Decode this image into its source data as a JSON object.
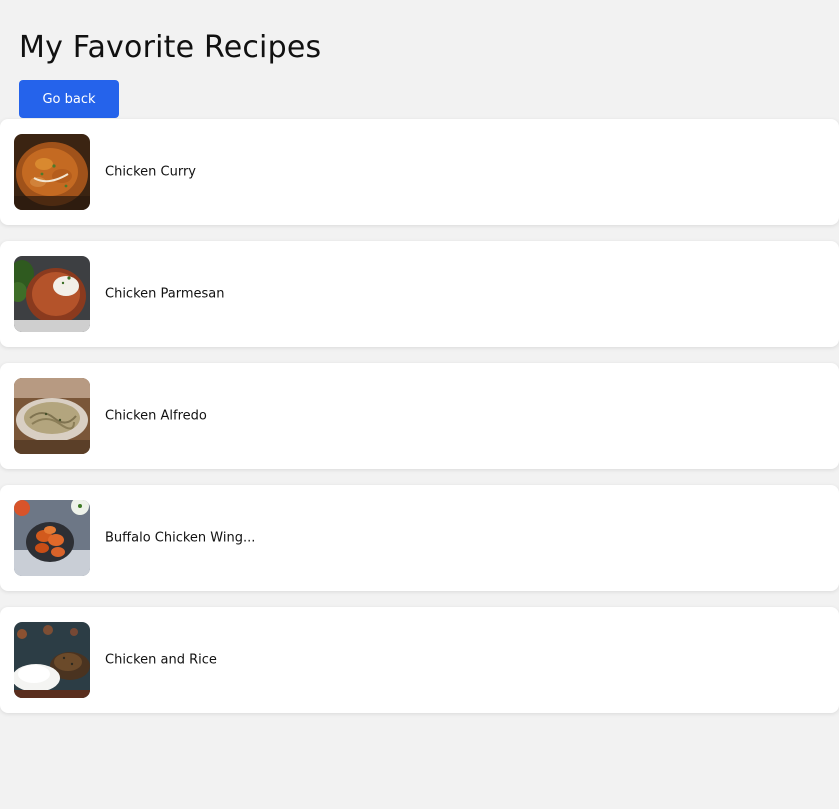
{
  "page": {
    "title": "My Favorite Recipes",
    "back_button_label": "Go back",
    "accent_color": "#2563eb"
  },
  "recipes": [
    {
      "name": "Chicken Curry",
      "image": "chicken-curry-photo"
    },
    {
      "name": "Chicken Parmesan",
      "image": "chicken-parmesan-photo"
    },
    {
      "name": "Chicken Alfredo",
      "image": "chicken-alfredo-photo"
    },
    {
      "name": "Buffalo Chicken Wing...",
      "image": "buffalo-chicken-wings-photo"
    },
    {
      "name": "Chicken and Rice",
      "image": "chicken-and-rice-photo"
    }
  ]
}
